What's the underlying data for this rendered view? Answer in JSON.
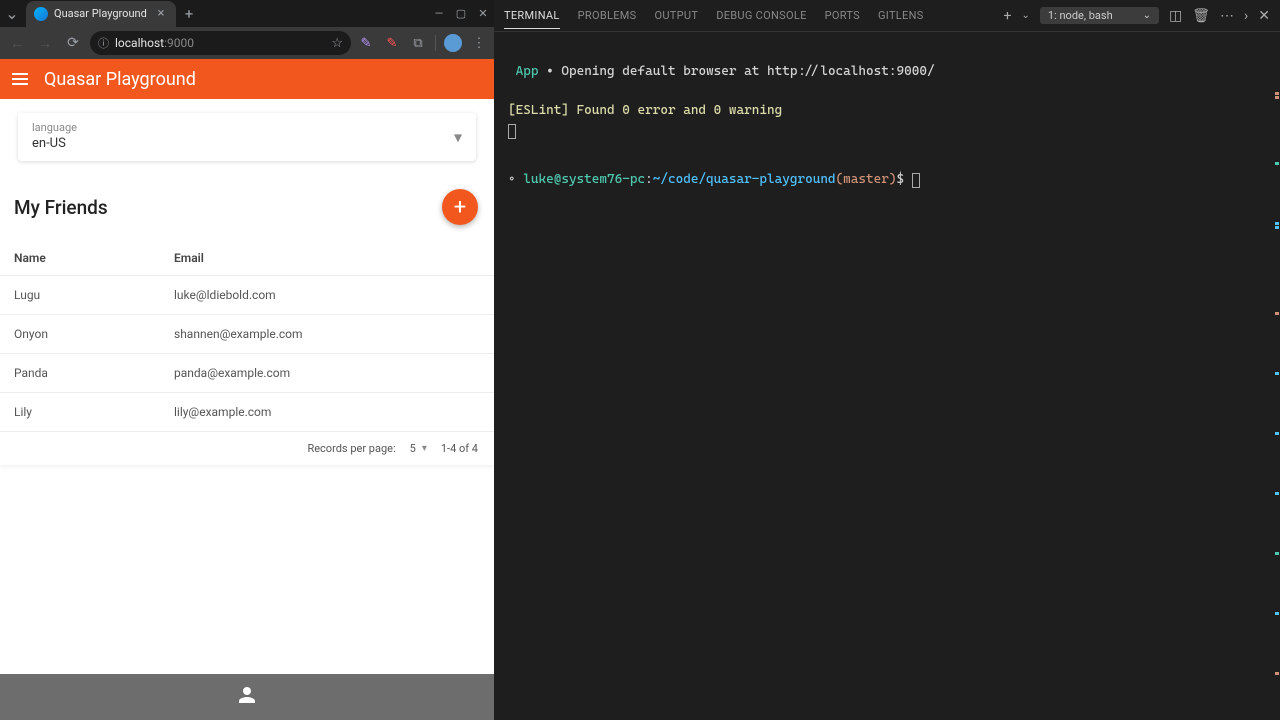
{
  "browser": {
    "tab_title": "Quasar Playground",
    "url_host": "localhost",
    "url_port": ":9000"
  },
  "app": {
    "title": "Quasar Playground",
    "language": {
      "label": "language",
      "value": "en-US"
    },
    "friends": {
      "title": "My Friends",
      "columns": {
        "name": "Name",
        "email": "Email"
      },
      "rows": [
        {
          "name": "Lugu",
          "email": "luke@ldiebold.com"
        },
        {
          "name": "Onyon",
          "email": "shannen@example.com"
        },
        {
          "name": "Panda",
          "email": "panda@example.com"
        },
        {
          "name": "Lily",
          "email": "lily@example.com"
        }
      ],
      "footer": {
        "records_label": "Records per page:",
        "per_page": "5",
        "range": "1-4 of 4"
      }
    }
  },
  "editor": {
    "tabs": [
      "TERMINAL",
      "PROBLEMS",
      "OUTPUT",
      "DEBUG CONSOLE",
      "PORTS",
      "GITLENS"
    ],
    "active_tab": "TERMINAL",
    "term_select": "1: node, bash",
    "lines": {
      "l1_app": " App ",
      "l1_dot": "•",
      "l1_rest": " Opening default browser at http://localhost:9000/",
      "l2": "[ESLint] Found 0 error and 0 warning",
      "prompt_lead": "◦ ",
      "prompt_user": "luke@system76-pc",
      "prompt_sep": ":",
      "prompt_path": "~/code/quasar-playground",
      "prompt_branch": "(master)",
      "prompt_dollar": "$"
    }
  }
}
